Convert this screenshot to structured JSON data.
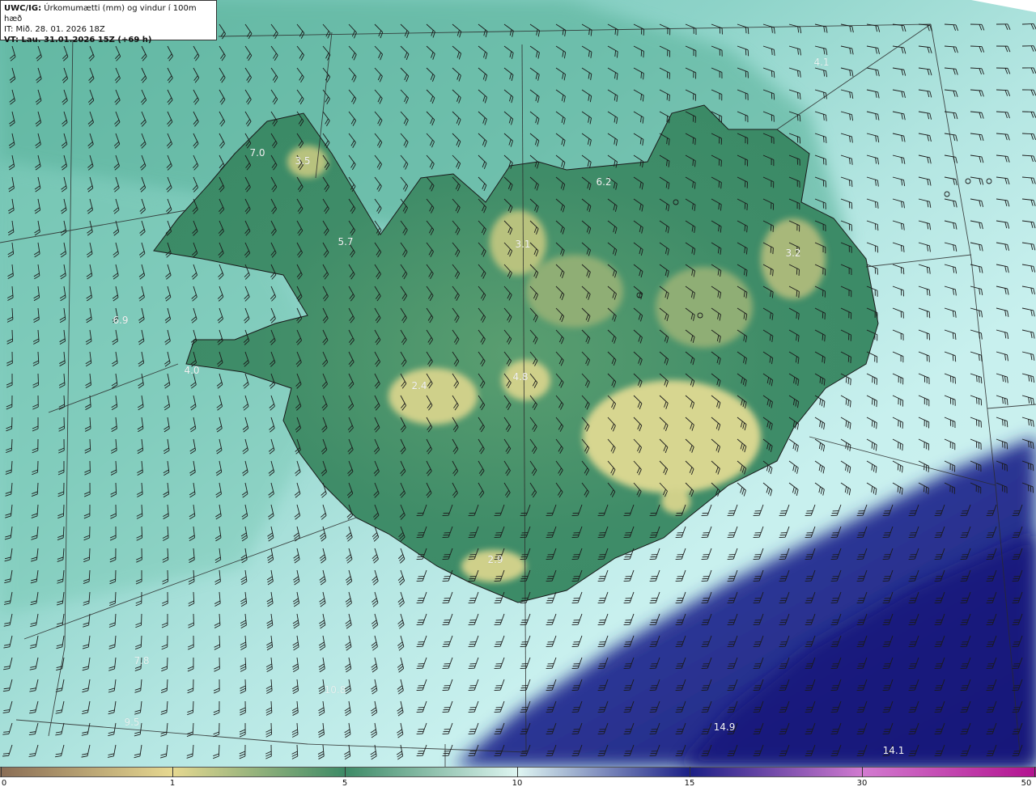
{
  "header": {
    "title_bold": "UWC/IG:",
    "title_rest": " Úrkomumætti (mm) og vindur í 100m hæð",
    "it_line": "IT: Mið. 28. 01. 2026 18Z",
    "vt_line": "VT: Lau. 31.01.2026 15Z (+69 h)"
  },
  "map_labels": [
    {
      "text": "7.0"
    },
    {
      "text": "3.5"
    },
    {
      "text": "3.1"
    },
    {
      "text": "3.2"
    },
    {
      "text": "6.9"
    },
    {
      "text": "4.0"
    },
    {
      "text": "2.4"
    },
    {
      "text": "2.9"
    },
    {
      "text": "7.8"
    },
    {
      "text": "10.8"
    },
    {
      "text": "14.9"
    },
    {
      "text": "14.1"
    },
    {
      "text": "4.8"
    },
    {
      "text": "6.2"
    },
    {
      "text": "5.7"
    },
    {
      "text": "4.1"
    },
    {
      "text": "9.5"
    }
  ],
  "colorbar": {
    "ticks": [
      "0",
      "1",
      "5",
      "10",
      "15",
      "30",
      "50"
    ],
    "colors": [
      "#8a6d55",
      "#e6d890",
      "#3d8a66",
      "#dff6f2",
      "#1b1f86",
      "#d27bd0",
      "#b3128f"
    ]
  },
  "icons": [
    "wind-barb-icon",
    "calm-circle-icon"
  ]
}
